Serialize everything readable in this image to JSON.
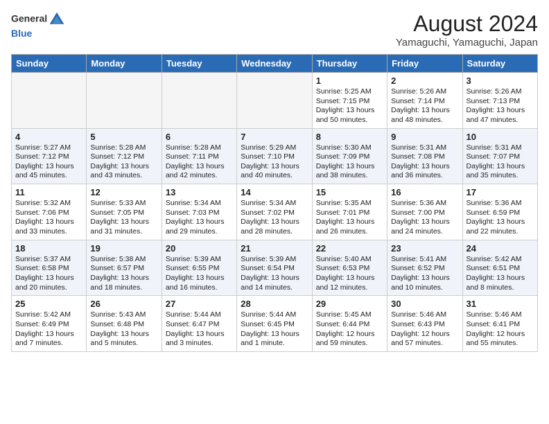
{
  "header": {
    "logo_line1": "General",
    "logo_line2": "Blue",
    "title": "August 2024",
    "subtitle": "Yamaguchi, Yamaguchi, Japan"
  },
  "calendar": {
    "days_of_week": [
      "Sunday",
      "Monday",
      "Tuesday",
      "Wednesday",
      "Thursday",
      "Friday",
      "Saturday"
    ],
    "weeks": [
      [
        {
          "day": "",
          "content": ""
        },
        {
          "day": "",
          "content": ""
        },
        {
          "day": "",
          "content": ""
        },
        {
          "day": "",
          "content": ""
        },
        {
          "day": "1",
          "content": "Sunrise: 5:25 AM\nSunset: 7:15 PM\nDaylight: 13 hours\nand 50 minutes."
        },
        {
          "day": "2",
          "content": "Sunrise: 5:26 AM\nSunset: 7:14 PM\nDaylight: 13 hours\nand 48 minutes."
        },
        {
          "day": "3",
          "content": "Sunrise: 5:26 AM\nSunset: 7:13 PM\nDaylight: 13 hours\nand 47 minutes."
        }
      ],
      [
        {
          "day": "4",
          "content": "Sunrise: 5:27 AM\nSunset: 7:12 PM\nDaylight: 13 hours\nand 45 minutes."
        },
        {
          "day": "5",
          "content": "Sunrise: 5:28 AM\nSunset: 7:12 PM\nDaylight: 13 hours\nand 43 minutes."
        },
        {
          "day": "6",
          "content": "Sunrise: 5:28 AM\nSunset: 7:11 PM\nDaylight: 13 hours\nand 42 minutes."
        },
        {
          "day": "7",
          "content": "Sunrise: 5:29 AM\nSunset: 7:10 PM\nDaylight: 13 hours\nand 40 minutes."
        },
        {
          "day": "8",
          "content": "Sunrise: 5:30 AM\nSunset: 7:09 PM\nDaylight: 13 hours\nand 38 minutes."
        },
        {
          "day": "9",
          "content": "Sunrise: 5:31 AM\nSunset: 7:08 PM\nDaylight: 13 hours\nand 36 minutes."
        },
        {
          "day": "10",
          "content": "Sunrise: 5:31 AM\nSunset: 7:07 PM\nDaylight: 13 hours\nand 35 minutes."
        }
      ],
      [
        {
          "day": "11",
          "content": "Sunrise: 5:32 AM\nSunset: 7:06 PM\nDaylight: 13 hours\nand 33 minutes."
        },
        {
          "day": "12",
          "content": "Sunrise: 5:33 AM\nSunset: 7:05 PM\nDaylight: 13 hours\nand 31 minutes."
        },
        {
          "day": "13",
          "content": "Sunrise: 5:34 AM\nSunset: 7:03 PM\nDaylight: 13 hours\nand 29 minutes."
        },
        {
          "day": "14",
          "content": "Sunrise: 5:34 AM\nSunset: 7:02 PM\nDaylight: 13 hours\nand 28 minutes."
        },
        {
          "day": "15",
          "content": "Sunrise: 5:35 AM\nSunset: 7:01 PM\nDaylight: 13 hours\nand 26 minutes."
        },
        {
          "day": "16",
          "content": "Sunrise: 5:36 AM\nSunset: 7:00 PM\nDaylight: 13 hours\nand 24 minutes."
        },
        {
          "day": "17",
          "content": "Sunrise: 5:36 AM\nSunset: 6:59 PM\nDaylight: 13 hours\nand 22 minutes."
        }
      ],
      [
        {
          "day": "18",
          "content": "Sunrise: 5:37 AM\nSunset: 6:58 PM\nDaylight: 13 hours\nand 20 minutes."
        },
        {
          "day": "19",
          "content": "Sunrise: 5:38 AM\nSunset: 6:57 PM\nDaylight: 13 hours\nand 18 minutes."
        },
        {
          "day": "20",
          "content": "Sunrise: 5:39 AM\nSunset: 6:55 PM\nDaylight: 13 hours\nand 16 minutes."
        },
        {
          "day": "21",
          "content": "Sunrise: 5:39 AM\nSunset: 6:54 PM\nDaylight: 13 hours\nand 14 minutes."
        },
        {
          "day": "22",
          "content": "Sunrise: 5:40 AM\nSunset: 6:53 PM\nDaylight: 13 hours\nand 12 minutes."
        },
        {
          "day": "23",
          "content": "Sunrise: 5:41 AM\nSunset: 6:52 PM\nDaylight: 13 hours\nand 10 minutes."
        },
        {
          "day": "24",
          "content": "Sunrise: 5:42 AM\nSunset: 6:51 PM\nDaylight: 13 hours\nand 8 minutes."
        }
      ],
      [
        {
          "day": "25",
          "content": "Sunrise: 5:42 AM\nSunset: 6:49 PM\nDaylight: 13 hours\nand 7 minutes."
        },
        {
          "day": "26",
          "content": "Sunrise: 5:43 AM\nSunset: 6:48 PM\nDaylight: 13 hours\nand 5 minutes."
        },
        {
          "day": "27",
          "content": "Sunrise: 5:44 AM\nSunset: 6:47 PM\nDaylight: 13 hours\nand 3 minutes."
        },
        {
          "day": "28",
          "content": "Sunrise: 5:44 AM\nSunset: 6:45 PM\nDaylight: 13 hours\nand 1 minute."
        },
        {
          "day": "29",
          "content": "Sunrise: 5:45 AM\nSunset: 6:44 PM\nDaylight: 12 hours\nand 59 minutes."
        },
        {
          "day": "30",
          "content": "Sunrise: 5:46 AM\nSunset: 6:43 PM\nDaylight: 12 hours\nand 57 minutes."
        },
        {
          "day": "31",
          "content": "Sunrise: 5:46 AM\nSunset: 6:41 PM\nDaylight: 12 hours\nand 55 minutes."
        }
      ]
    ]
  }
}
